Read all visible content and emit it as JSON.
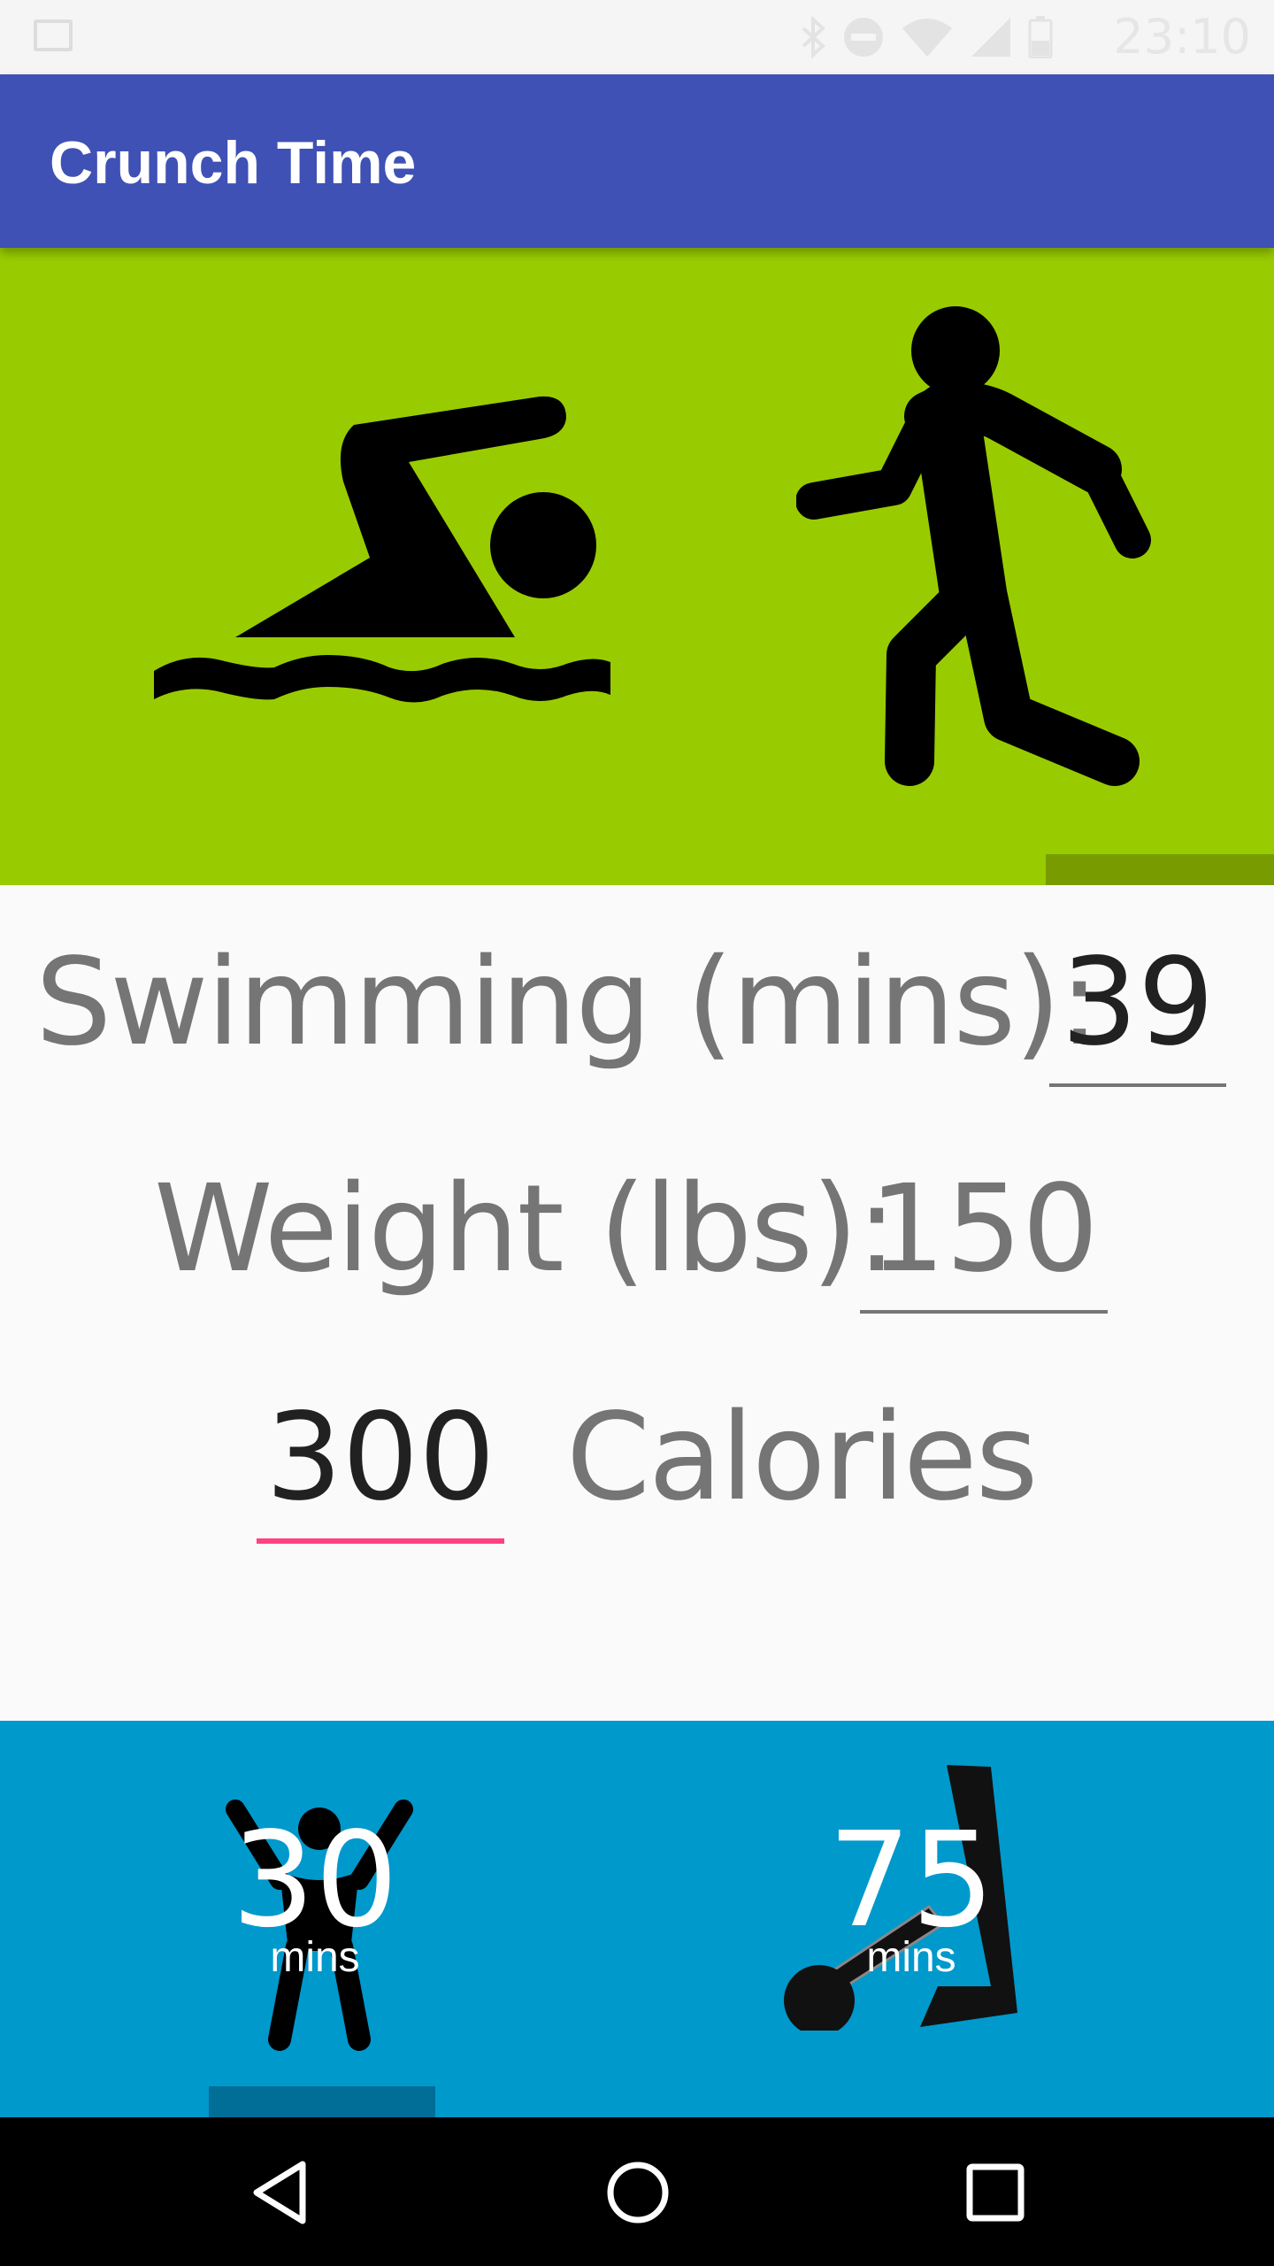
{
  "status_bar": {
    "time": "23:10",
    "icons": [
      "image-icon",
      "bluetooth-icon",
      "do-not-disturb-icon",
      "wifi-icon",
      "signal-icon",
      "battery-icon"
    ]
  },
  "app_bar": {
    "title": "Crunch Time",
    "color": "#3f51b5"
  },
  "top_pager": {
    "background": "#99cc00",
    "icons": [
      "swimming-icon",
      "walking-icon"
    ]
  },
  "swimming": {
    "label": "Swimming (mins):",
    "value": "39"
  },
  "weight": {
    "label": "Weight (lbs):",
    "value": "150"
  },
  "calories": {
    "value": "300",
    "label": "Calories",
    "accent": "#ff4081"
  },
  "bottom_pager": {
    "background": "#0099cc",
    "items": [
      {
        "icon": "jumping-jacks-icon",
        "value": "30",
        "unit": "mins"
      },
      {
        "icon": "leg-lift-icon",
        "value": "75",
        "unit": "mins"
      }
    ]
  },
  "nav_bar": {
    "buttons": [
      "back-button",
      "home-button",
      "recents-button"
    ]
  }
}
